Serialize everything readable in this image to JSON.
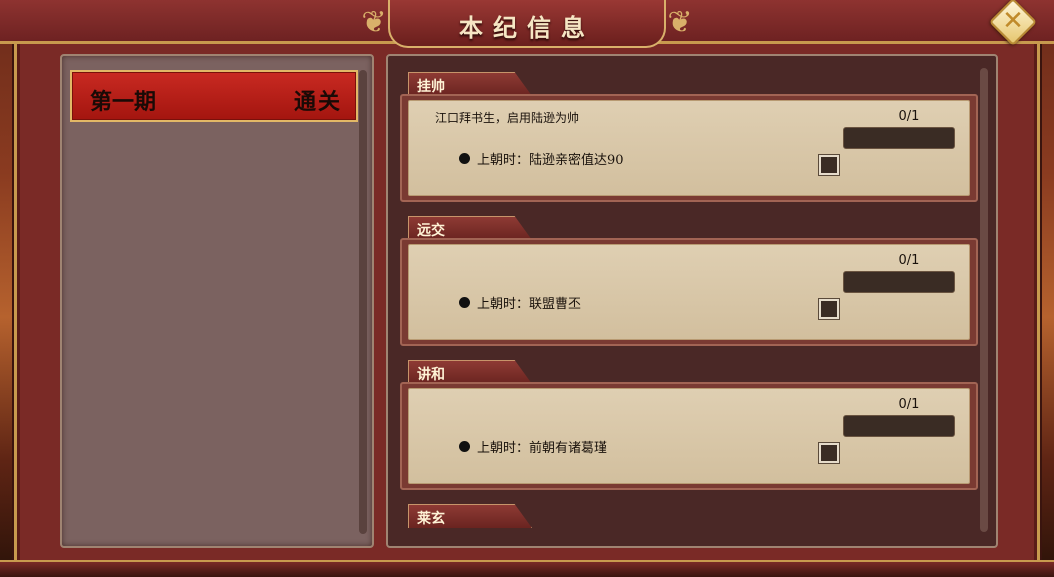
{
  "window": {
    "title": "本纪信息",
    "close_icon": "close-icon"
  },
  "periods": [
    {
      "name": "第一期",
      "status": "通关"
    }
  ],
  "quests": [
    {
      "tab": "挂帅",
      "description": "江口拜书生，启用陆逊为帅",
      "progress": "0/1",
      "condition_bullet": "●",
      "condition": "上朝时：陆逊亲密值达90"
    },
    {
      "tab": "远交",
      "description": "",
      "progress": "0/1",
      "condition_bullet": "●",
      "condition": "上朝时：联盟曹丕"
    },
    {
      "tab": "讲和",
      "description": "",
      "progress": "0/1",
      "condition_bullet": "●",
      "condition": "上朝时：前朝有诸葛瑾"
    },
    {
      "tab": "莱玄"
    }
  ],
  "colors": {
    "frame": "#7a2a26",
    "gold_trim": "#c89a4e",
    "selected_period": "#c92a22",
    "paper": "#dfcfb2"
  }
}
